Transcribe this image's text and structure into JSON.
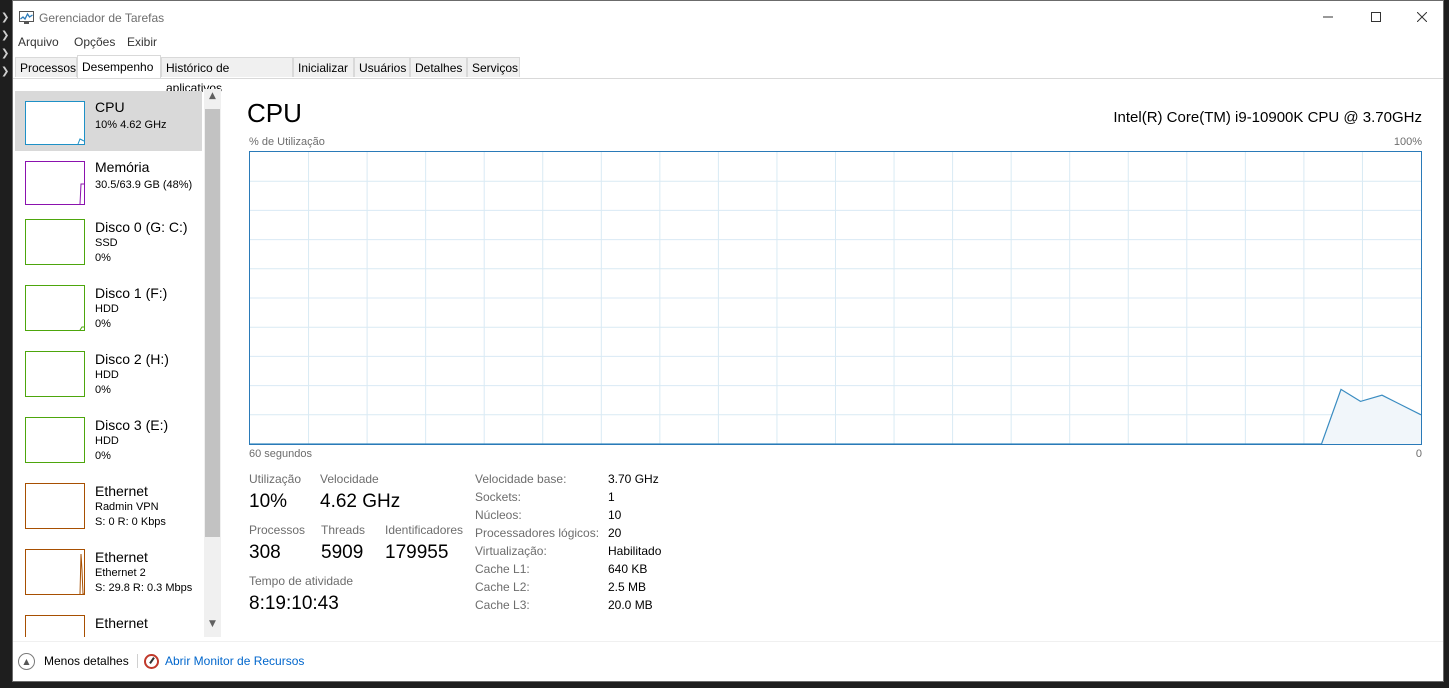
{
  "window": {
    "title": "Gerenciador de Tarefas"
  },
  "menu": [
    "Arquivo",
    "Opções",
    "Exibir"
  ],
  "tabs": [
    "Processos",
    "Desempenho",
    "Histórico de aplicativos",
    "Inicializar",
    "Usuários",
    "Detalhes",
    "Serviços"
  ],
  "sidebar": {
    "items": [
      {
        "title": "CPU",
        "line1": "10%  4.62 GHz",
        "line2": "",
        "color": "#1e90c6"
      },
      {
        "title": "Memória",
        "line1": "30.5/63.9 GB (48%)",
        "line2": "",
        "color": "#8b12ae"
      },
      {
        "title": "Disco 0 (G: C:)",
        "line1": "SSD",
        "line2": "0%",
        "color": "#4da60c"
      },
      {
        "title": "Disco 1 (F:)",
        "line1": "HDD",
        "line2": "0%",
        "color": "#4da60c"
      },
      {
        "title": "Disco 2 (H:)",
        "line1": "HDD",
        "line2": "0%",
        "color": "#4da60c"
      },
      {
        "title": "Disco 3 (E:)",
        "line1": "HDD",
        "line2": "0%",
        "color": "#4da60c"
      },
      {
        "title": "Ethernet",
        "line1": "Radmin VPN",
        "line2": "S: 0  R: 0 Kbps",
        "color": "#a74f01"
      },
      {
        "title": "Ethernet",
        "line1": "Ethernet 2",
        "line2": "S: 29.8  R: 0.3 Mbps",
        "color": "#a74f01"
      },
      {
        "title": "Ethernet",
        "line1": "",
        "line2": "",
        "color": "#a74f01"
      }
    ]
  },
  "main": {
    "title": "CPU",
    "model": "Intel(R) Core(TM) i9-10900K CPU @ 3.70GHz",
    "graph_label": "% de Utilização",
    "graph_max": "100%",
    "time_label": "60 segundos",
    "time_min": "0"
  },
  "stats": {
    "util_label": "Utilização",
    "util_value": "10%",
    "speed_label": "Velocidade",
    "speed_value": "4.62 GHz",
    "proc_label": "Processos",
    "proc_value": "308",
    "threads_label": "Threads",
    "threads_value": "5909",
    "handles_label": "Identificadores",
    "handles_value": "179955",
    "uptime_label": "Tempo de atividade",
    "uptime_value": "8:19:10:43"
  },
  "specs": [
    {
      "label": "Velocidade base:",
      "value": "3.70 GHz"
    },
    {
      "label": "Sockets:",
      "value": "1"
    },
    {
      "label": "Núcleos:",
      "value": "10"
    },
    {
      "label": "Processadores lógicos:",
      "value": "20"
    },
    {
      "label": "Virtualização:",
      "value": "Habilitado"
    },
    {
      "label": "Cache L1:",
      "value": "640 KB"
    },
    {
      "label": "Cache L2:",
      "value": "2.5 MB"
    },
    {
      "label": "Cache L3:",
      "value": "20.0 MB"
    }
  ],
  "bottom": {
    "less_details": "Menos detalhes",
    "open_monitor": "Abrir Monitor de Recursos"
  },
  "chart_data": {
    "type": "area",
    "ylim": [
      0,
      100
    ],
    "xlim": [
      60,
      0
    ],
    "x": [
      60,
      5.1,
      4.1,
      3.1,
      2.0,
      0
    ],
    "y": [
      0,
      0,
      18.7,
      14.6,
      16.7,
      10
    ],
    "grid": true
  }
}
